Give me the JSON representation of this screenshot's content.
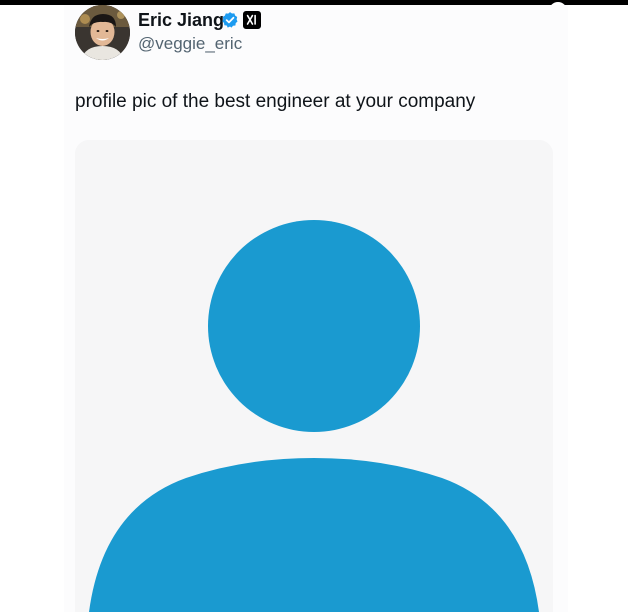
{
  "tweet": {
    "author": {
      "display_name": "Eric Jiang",
      "handle": "@veggie_eric",
      "verified_icon": "verified-badge-icon",
      "affiliate_icon": "affiliate-logo-icon"
    },
    "text": "profile pic of the best engineer at your company",
    "media": {
      "icon": "default-profile-silhouette-icon"
    }
  },
  "colors": {
    "text_primary": "#0f1419",
    "text_secondary": "#536471",
    "verified_blue": "#1d9bf0",
    "silhouette_blue": "#1a9ad0",
    "media_background": "#f6f6f7"
  }
}
